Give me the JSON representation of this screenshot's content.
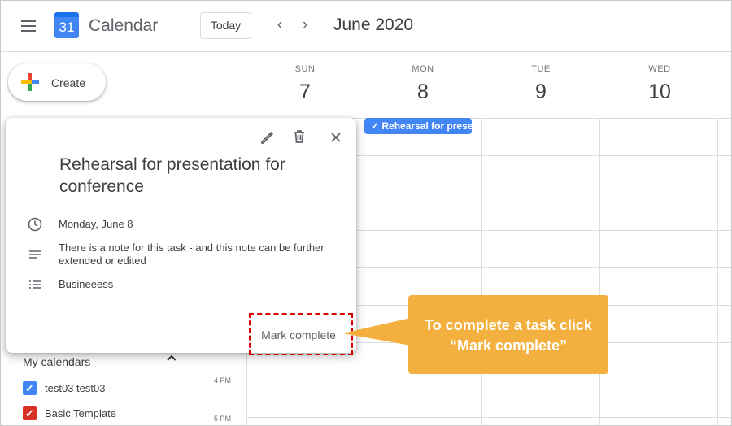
{
  "header": {
    "app_title": "Calendar",
    "logo_day": "31",
    "today_label": "Today",
    "prev_arrow": "‹",
    "next_arrow": "›",
    "month_title": "June 2020"
  },
  "create": {
    "label": "Create"
  },
  "days": [
    {
      "name": "SUN",
      "num": "7"
    },
    {
      "name": "MON",
      "num": "8"
    },
    {
      "name": "TUE",
      "num": "9"
    },
    {
      "name": "WED",
      "num": "10"
    }
  ],
  "task_chip": {
    "label": "Rehearsal for presentation for conference",
    "color": "#4285f4"
  },
  "popup": {
    "title": "Rehearsal for presentation for conference",
    "date": "Monday, June 8",
    "note": "There is a note for this task - and this note can be further extended or edited",
    "list": "Busineeess",
    "mark_complete": "Mark complete"
  },
  "sidebar": {
    "my_calendars": "My calendars",
    "calendars": [
      {
        "label": "test03 test03",
        "color": "#4285f4"
      },
      {
        "label": "Basic Template",
        "color": "#d93025"
      }
    ]
  },
  "time_labels": [
    "4 PM",
    "5 PM"
  ],
  "callout": {
    "line1": "To complete a task click",
    "line2": "“Mark complete”",
    "color": "#f4b03e"
  },
  "icons": {
    "menu": "hamburger-menu-icon",
    "edit": "pencil-icon",
    "delete": "trash-icon",
    "close": "close-icon",
    "date": "clock-icon",
    "note": "notes-icon",
    "list": "list-icon",
    "chevron": "chevron-up-icon",
    "check": "check-icon"
  }
}
